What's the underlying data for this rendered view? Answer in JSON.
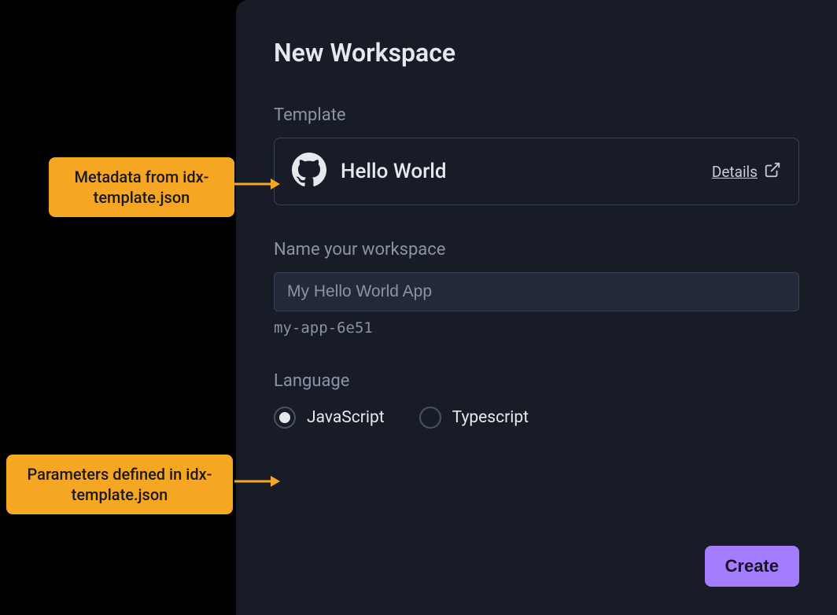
{
  "dialog": {
    "title": "New Workspace",
    "template": {
      "section_label": "Template",
      "name": "Hello World",
      "details_label": "Details"
    },
    "name_section": {
      "label": "Name your workspace",
      "value": "My Hello World App",
      "slug": "my-app-6e51"
    },
    "language": {
      "label": "Language",
      "options": [
        {
          "label": "JavaScript",
          "selected": true
        },
        {
          "label": "Typescript",
          "selected": false
        }
      ]
    },
    "create_label": "Create"
  },
  "callouts": {
    "metadata": "Metadata from idx-template.json",
    "parameters": "Parameters defined in idx-template.json"
  },
  "colors": {
    "dialog_bg": "#171c27",
    "accent": "#a47cff",
    "callout_bg": "#f5a623"
  }
}
